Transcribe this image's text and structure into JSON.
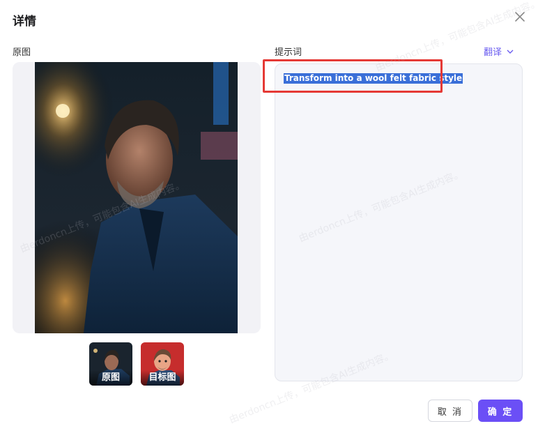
{
  "dialog": {
    "title": "详情",
    "close_icon": "close-icon"
  },
  "left": {
    "label": "原图",
    "thumbnails": [
      {
        "caption": "原图"
      },
      {
        "caption": "目标图"
      }
    ]
  },
  "right": {
    "label": "提示词",
    "translate_label": "翻译",
    "prompt_text": "Transform into a wool felt fabric style"
  },
  "footer": {
    "cancel_label": "取 消",
    "ok_label": "确 定"
  },
  "colors": {
    "accent": "#6b4ff6",
    "link": "#6a5cf0",
    "highlight_border": "#e53935",
    "selection": "#3a6fd8"
  },
  "watermark": "由erdoncn上传，可能包含AI生成内容。"
}
